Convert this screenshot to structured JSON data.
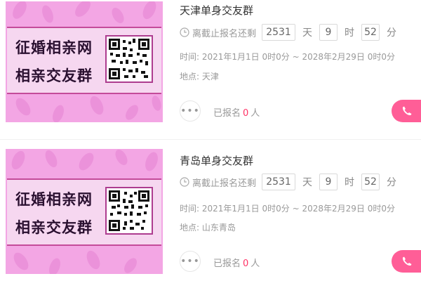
{
  "colors": {
    "accent": "#ff5e97",
    "count": "#ff3366",
    "poster_pink": "#f3a6e4"
  },
  "events": [
    {
      "title": "天津单身交友群",
      "poster": {
        "line1": "征婚相亲网",
        "line2": "相亲交友群",
        "icon": "qr-code"
      },
      "countdown": {
        "label": "离截止报名还剩",
        "days": "2531",
        "day_unit": "天",
        "hours": "9",
        "hour_unit": "时",
        "minutes": "52",
        "minute_unit": "分"
      },
      "time_label": "时间:",
      "time_value": "2021年1月1日 0时0分 ~ 2028年2月29日 0时0分",
      "place_label": "地点:",
      "place_value": "天津",
      "signup_prefix": "已报名",
      "signup_count": "0",
      "signup_suffix": "人"
    },
    {
      "title": "青岛单身交友群",
      "poster": {
        "line1": "征婚相亲网",
        "line2": "相亲交友群",
        "icon": "qr-code"
      },
      "countdown": {
        "label": "离截止报名还剩",
        "days": "2531",
        "day_unit": "天",
        "hours": "9",
        "hour_unit": "时",
        "minutes": "52",
        "minute_unit": "分"
      },
      "time_label": "时间:",
      "time_value": "2021年1月1日 0时0分 ~ 2028年2月29日 0时0分",
      "place_label": "地点:",
      "place_value": "山东青岛",
      "signup_prefix": "已报名",
      "signup_count": "0",
      "signup_suffix": "人"
    }
  ],
  "icons": {
    "clock": "clock-icon",
    "more": "more-dots-icon",
    "phone": "phone-icon"
  }
}
